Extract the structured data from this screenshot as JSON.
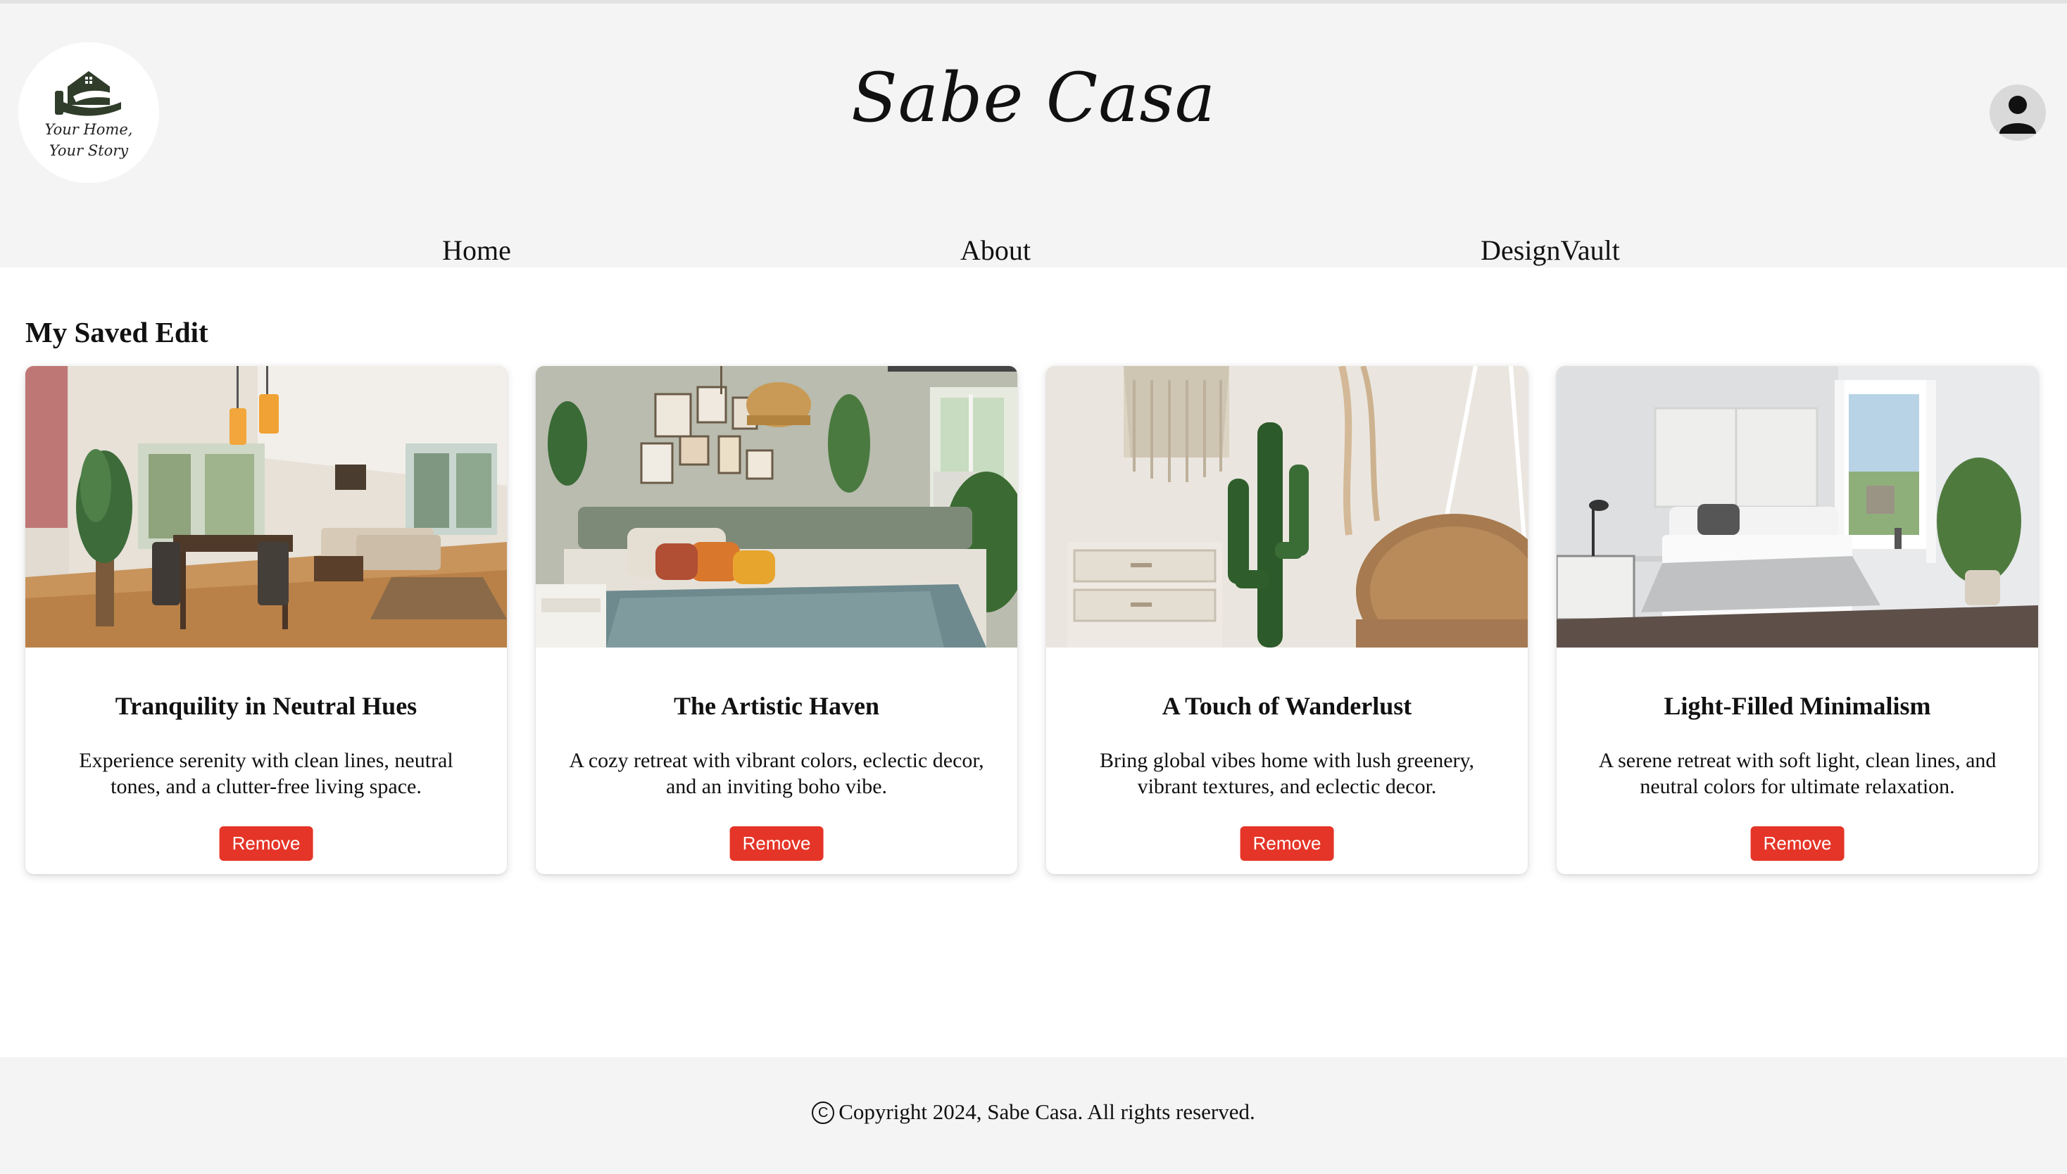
{
  "header": {
    "site_title": "Sabe Casa",
    "logo_tagline_line1": "Your Home,",
    "logo_tagline_line2": "Your Story",
    "logo_icon": "house-hand-icon",
    "profile_icon": "user-icon"
  },
  "nav": {
    "items": [
      {
        "label": "Home"
      },
      {
        "label": "About"
      },
      {
        "label": "DesignVault"
      }
    ]
  },
  "main": {
    "section_title": "My Saved Edit",
    "cards": [
      {
        "title": "Tranquility in Neutral Hues",
        "description": "Experience serenity with clean lines, neutral tones, and a clutter-free living space.",
        "button_label": "Remove"
      },
      {
        "title": "The Artistic Haven",
        "description": "A cozy retreat with vibrant colors, eclectic decor, and an inviting boho vibe.",
        "button_label": "Remove"
      },
      {
        "title": "A Touch of Wanderlust",
        "description": "Bring global vibes home with lush greenery, vibrant textures, and eclectic decor.",
        "button_label": "Remove"
      },
      {
        "title": "Light-Filled Minimalism",
        "description": "A serene retreat with soft light, clean lines, and neutral colors for ultimate relaxation.",
        "button_label": "Remove"
      }
    ]
  },
  "footer": {
    "copyright_symbol": "C",
    "copyright_text": "Copyright 2024, Sabe Casa. All rights reserved."
  },
  "colors": {
    "header_bg": "#f4f4f4",
    "footer_bg": "#f4f4f4",
    "remove_button": "#e53528",
    "logo_green": "#2f3d2a"
  }
}
